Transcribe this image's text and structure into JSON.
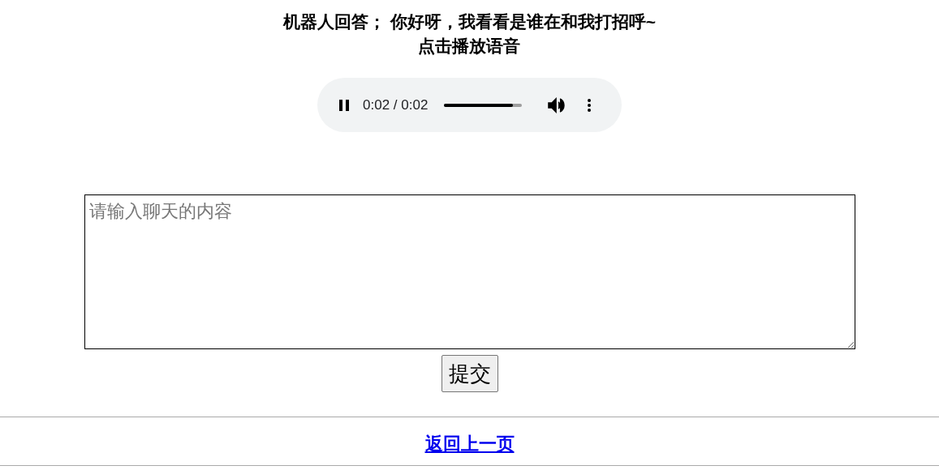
{
  "reply": {
    "lines": [
      "机器人回答； 你好呀，我看看是谁在和我打招呼~",
      "点击播放语音"
    ]
  },
  "audio_player": {
    "playing": true,
    "time": "0:02 / 0:02",
    "level": 0.88
  },
  "chat_input": {
    "placeholder": "请输入聊天的内容"
  },
  "submit_button": {
    "label": "提交"
  },
  "back_link": {
    "label": "返回上一页"
  }
}
